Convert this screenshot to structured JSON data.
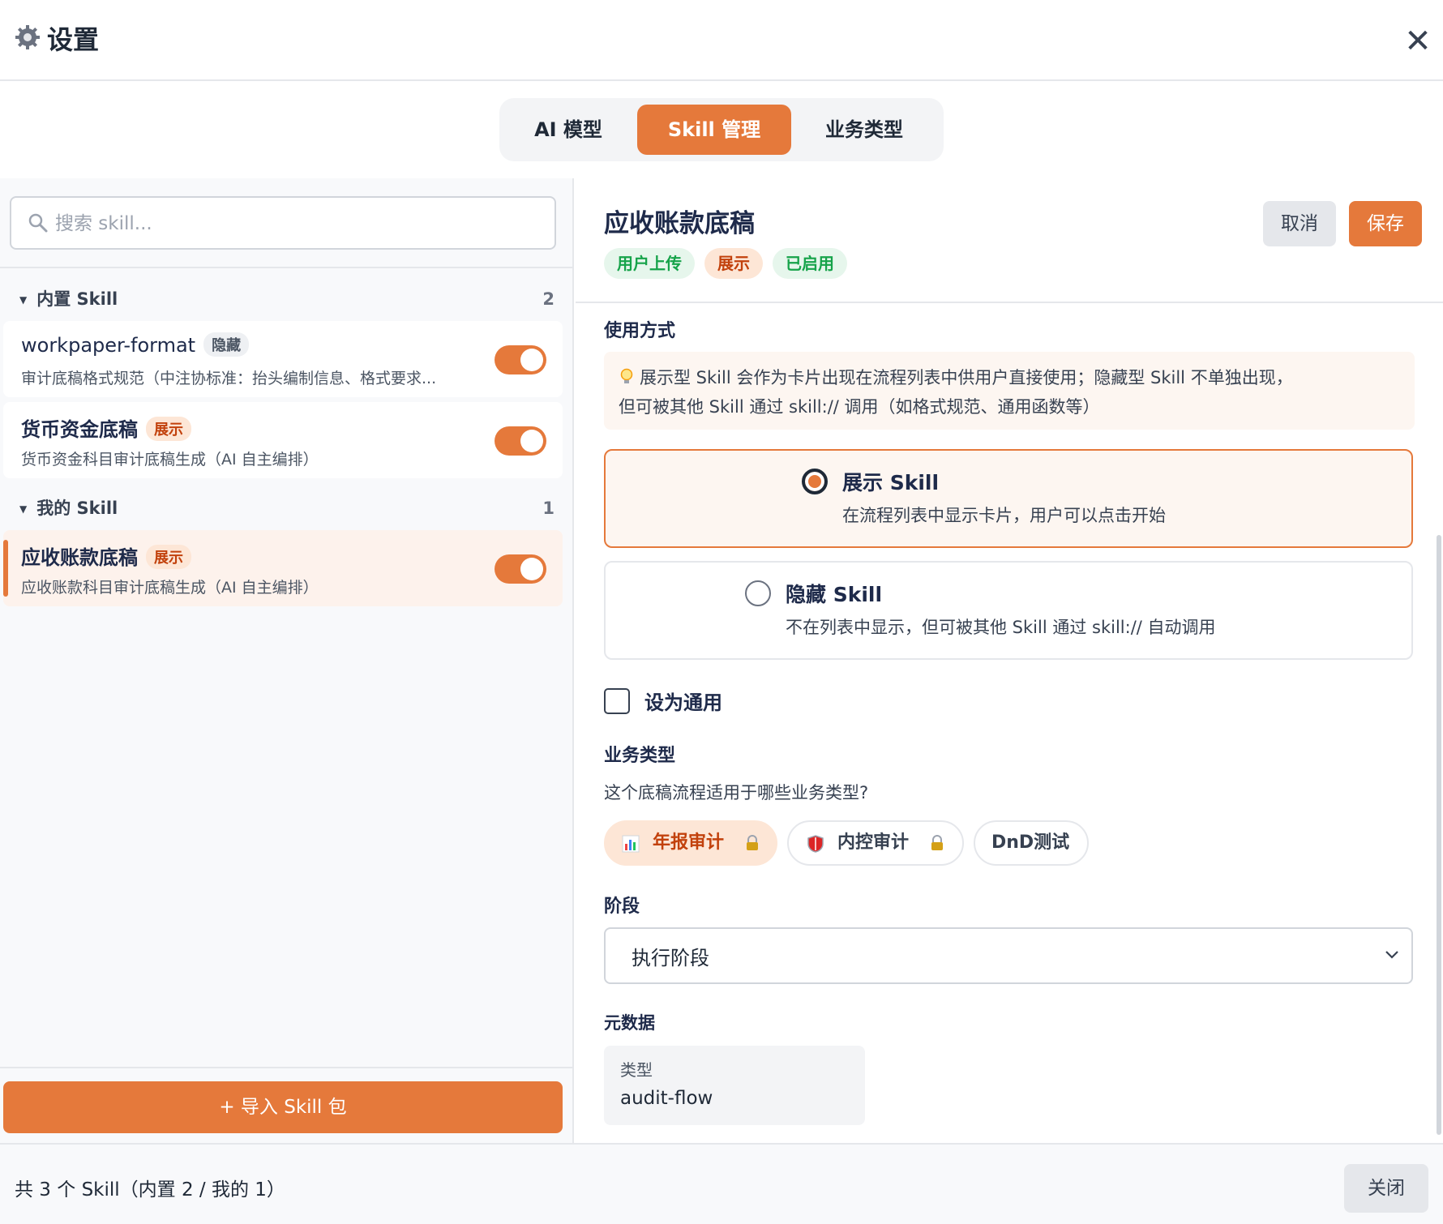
{
  "window": {
    "title": "设置",
    "icon": "gear-icon",
    "close": "✕"
  },
  "tabs": [
    {
      "label": "AI 模型",
      "active": false
    },
    {
      "label": "Skill 管理",
      "active": true
    },
    {
      "label": "业务类型",
      "active": false
    }
  ],
  "sidebar": {
    "search_placeholder": "搜索 skill...",
    "groups": [
      {
        "label": "内置 Skill",
        "count": "2",
        "items": [
          {
            "name": "workpaper-format",
            "badge": "隐藏",
            "desc": "审计底稿格式规范（中注协标准：抬头编制信息、格式要求...",
            "enabled": true
          },
          {
            "name": "货币资金底稿",
            "badge": "展示",
            "desc": "货币资金科目审计底稿生成（AI 自主编排）",
            "enabled": true
          }
        ]
      },
      {
        "label": "我的 Skill",
        "count": "1",
        "items": [
          {
            "name": "应收账款底稿",
            "badge": "展示",
            "desc": "应收账款科目审计底稿生成（AI 自主编排）",
            "enabled": true,
            "selected": true
          }
        ]
      }
    ],
    "import_label": "+ 导入 Skill 包"
  },
  "detail": {
    "title": "应收账款底稿",
    "chips": [
      "用户上传",
      "展示",
      "已启用"
    ],
    "cancel_label": "取消",
    "save_label": "保存",
    "usage": {
      "label": "使用方式",
      "info_line1": "展示型 Skill 会作为卡片出现在流程列表中供用户直接使用；隐藏型 Skill 不单独出现，",
      "info_line2": "但可被其他 Skill 通过 skill:// 调用（如格式规范、通用函数等）",
      "options": [
        {
          "title": "展示 Skill",
          "desc": "在流程列表中显示卡片，用户可以点击开始",
          "selected": true
        },
        {
          "title": "隐藏 Skill",
          "desc": "不在列表中显示，但可被其他 Skill 通过 skill:// 自动调用",
          "selected": false
        }
      ]
    },
    "general_checkbox": {
      "label": "设为通用",
      "checked": false
    },
    "business": {
      "label": "业务类型",
      "question": "这个底稿流程适用于哪些业务类型?",
      "pills": [
        {
          "label": "年报审计",
          "icon": "bar-chart-icon",
          "locked": true,
          "selected": true
        },
        {
          "label": "内控审计",
          "icon": "shield-icon",
          "locked": true,
          "selected": false
        },
        {
          "label": "DnD测试",
          "locked": false,
          "selected": false
        }
      ]
    },
    "stage": {
      "label": "阶段",
      "value": "执行阶段"
    },
    "metadata": {
      "label": "元数据",
      "key": "类型",
      "value": "audit-flow"
    }
  },
  "footer": {
    "summary": "共 3 个 Skill（内置 2 / 我的 1）",
    "close_label": "关闭"
  },
  "colors": {
    "accent": "#e5793b",
    "green": "#16a34a",
    "text": "#1e2a4a"
  }
}
